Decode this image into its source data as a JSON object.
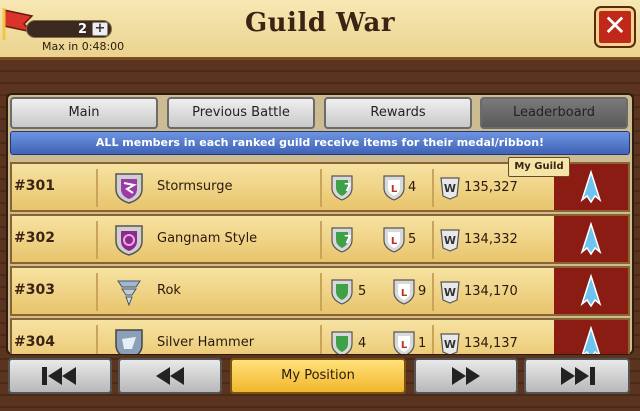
{
  "header": {
    "title": "Guild War",
    "energy_count": "2",
    "energy_timer": "Max in 0:48:00",
    "plus": "+",
    "close": "✕"
  },
  "tabs": [
    {
      "label": "Main",
      "active": false
    },
    {
      "label": "Previous Battle",
      "active": false
    },
    {
      "label": "Rewards",
      "active": false
    },
    {
      "label": "Leaderboard",
      "active": true
    }
  ],
  "banner": "ALL members in each ranked guild receive items for their medal/ribbon!",
  "my_guild_tag": "My Guild",
  "rows": [
    {
      "rank": "#301",
      "name": "Stormsurge",
      "wins": "7",
      "losses": "4",
      "points": "135,327",
      "emblem": "purple-dragon",
      "my_guild": true
    },
    {
      "rank": "#302",
      "name": "Gangnam Style",
      "wins": "7",
      "losses": "5",
      "points": "134,332",
      "emblem": "purple-swirl",
      "my_guild": false
    },
    {
      "rank": "#303",
      "name": "Rok",
      "wins": "5",
      "losses": "9",
      "points": "134,170",
      "emblem": "tornado",
      "my_guild": false
    },
    {
      "rank": "#304",
      "name": "Silver Hammer",
      "wins": "4",
      "losses": "1",
      "points": "134,137",
      "emblem": "silver-beast",
      "my_guild": false
    }
  ],
  "nav": {
    "first": "first-page-icon",
    "prev": "previous-page-icon",
    "my_position": "My Position",
    "next": "next-page-icon",
    "last": "last-page-icon"
  },
  "colors": {
    "row_bg": "#f0d48a",
    "ribbon_cell": "#8a1c14",
    "banner": "#4f75c8",
    "close": "#c0281c",
    "my_position": "#f2b62c"
  }
}
